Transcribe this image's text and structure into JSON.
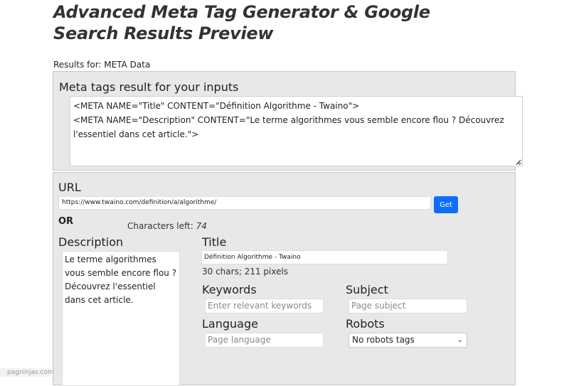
{
  "page": {
    "title": "Advanced Meta Tag Generator & Google Search Results Preview",
    "results_for": "Results for: META Data"
  },
  "meta_result": {
    "heading": "Meta tags result for your inputs",
    "lines": [
      "<META NAME=\"Title\" CONTENT=\"Définition Algorithme - Twaino\">",
      "<META NAME=\"Description\" CONTENT=\"Le terme algorithmes vous semble encore flou ? Découvrez l'essentiel dans cet article.\">"
    ]
  },
  "form": {
    "url_label": "URL",
    "url_value": "https://www.twaino.com/definition/a/algorithme/",
    "get_button": "Get",
    "or_label": "OR",
    "chars_left_label": "Characters left:",
    "chars_left_value": "74",
    "description_label": "Description",
    "description_value": "Le terme algorithmes vous semble encore flou ? Découvrez l'essentiel dans cet article.",
    "title_label": "Title",
    "title_value": "Définition Algorithme - Twaino",
    "title_stats": "30 chars; 211 pixels",
    "keywords_label": "Keywords",
    "keywords_placeholder": "Enter relevant keywords",
    "subject_label": "Subject",
    "subject_placeholder": "Page subject",
    "language_label": "Language",
    "language_placeholder": "Page language",
    "robots_label": "Robots",
    "robots_selected": "No robots tags"
  },
  "icons": {
    "chevron": "chevron-down-icon",
    "resize": "resize-grip-icon"
  },
  "colors": {
    "accent": "#0d6efd",
    "panel": "#e8e8e8"
  },
  "footer": {
    "watermark": "pagninjas.com"
  }
}
